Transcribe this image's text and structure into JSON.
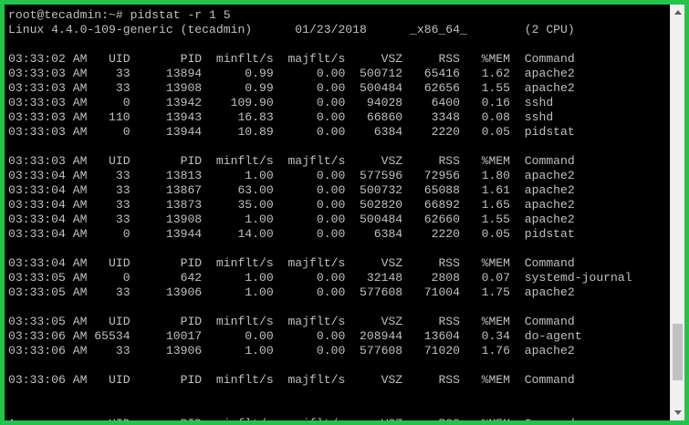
{
  "terminal": {
    "lines": [
      "root@tecadmin:~# pidstat -r 1 5",
      "Linux 4.4.0-109-generic (tecadmin)      01/23/2018      _x86_64_        (2 CPU)",
      "",
      "03:33:02 AM   UID       PID  minflt/s  majflt/s     VSZ     RSS   %MEM  Command",
      "03:33:03 AM    33     13894      0.99      0.00  500712   65416   1.62  apache2",
      "03:33:03 AM    33     13908      0.99      0.00  500484   62656   1.55  apache2",
      "03:33:03 AM     0     13942    109.90      0.00   94028    6400   0.16  sshd",
      "03:33:03 AM   110     13943     16.83      0.00   66860    3348   0.08  sshd",
      "03:33:03 AM     0     13944     10.89      0.00    6384    2220   0.05  pidstat",
      "",
      "03:33:03 AM   UID       PID  minflt/s  majflt/s     VSZ     RSS   %MEM  Command",
      "03:33:04 AM    33     13813      1.00      0.00  577596   72956   1.80  apache2",
      "03:33:04 AM    33     13867     63.00      0.00  500732   65088   1.61  apache2",
      "03:33:04 AM    33     13873     35.00      0.00  502820   66892   1.65  apache2",
      "03:33:04 AM    33     13908      1.00      0.00  500484   62660   1.55  apache2",
      "03:33:04 AM     0     13944     14.00      0.00    6384    2220   0.05  pidstat",
      "",
      "03:33:04 AM   UID       PID  minflt/s  majflt/s     VSZ     RSS   %MEM  Command",
      "03:33:05 AM     0       642      1.00      0.00   32148    2808   0.07  systemd-journal",
      "03:33:05 AM    33     13906      1.00      0.00  577608   71004   1.75  apache2",
      "",
      "03:33:05 AM   UID       PID  minflt/s  majflt/s     VSZ     RSS   %MEM  Command",
      "03:33:06 AM 65534     10017      0.00      0.00  208944   13604   0.34  do-agent",
      "03:33:06 AM    33     13906      1.00      0.00  577608   71020   1.76  apache2",
      "",
      "03:33:06 AM   UID       PID  minflt/s  majflt/s     VSZ     RSS   %MEM  Command",
      "",
      "",
      "Average:      UID       PID  minflt/s  majflt/s     VSZ     RSS   %MEM  Command"
    ]
  },
  "colors": {
    "frame": "#22c44a",
    "background": "#000000",
    "text": "#c0c0c0"
  },
  "icons": {
    "scroll_up": "triangle-up-icon",
    "scroll_down": "triangle-down-icon"
  }
}
